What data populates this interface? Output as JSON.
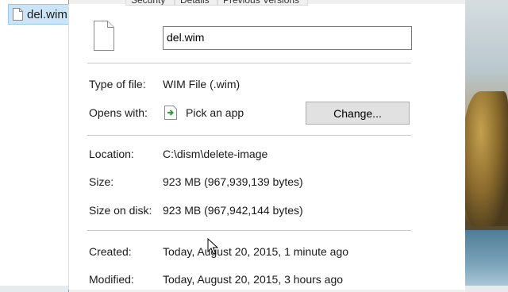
{
  "desktop": {
    "file_label": "del.wim"
  },
  "tabs": [
    "Security",
    "Details",
    "Previous Versions"
  ],
  "general": {
    "file_name": "del.wim",
    "type_of_file": {
      "label": "Type of file:",
      "value": "WIM File (.wim)"
    },
    "opens_with": {
      "label": "Opens with:",
      "app": "Pick an app",
      "button": "Change..."
    },
    "location": {
      "label": "Location:",
      "value": "C:\\dism\\delete-image"
    },
    "size": {
      "label": "Size:",
      "value": "923 MB (967,939,139 bytes)"
    },
    "size_on_disk": {
      "label": "Size on disk:",
      "value": "923 MB (967,942,144 bytes)"
    },
    "created": {
      "label": "Created:",
      "value": "Today, August 20, 2015, 1 minute ago"
    },
    "modified": {
      "label": "Modified:",
      "value": "Today, August 20, 2015, 3 hours ago"
    }
  },
  "icons": [
    "file-icon",
    "app-picker-icon",
    "mouse-cursor-icon"
  ]
}
